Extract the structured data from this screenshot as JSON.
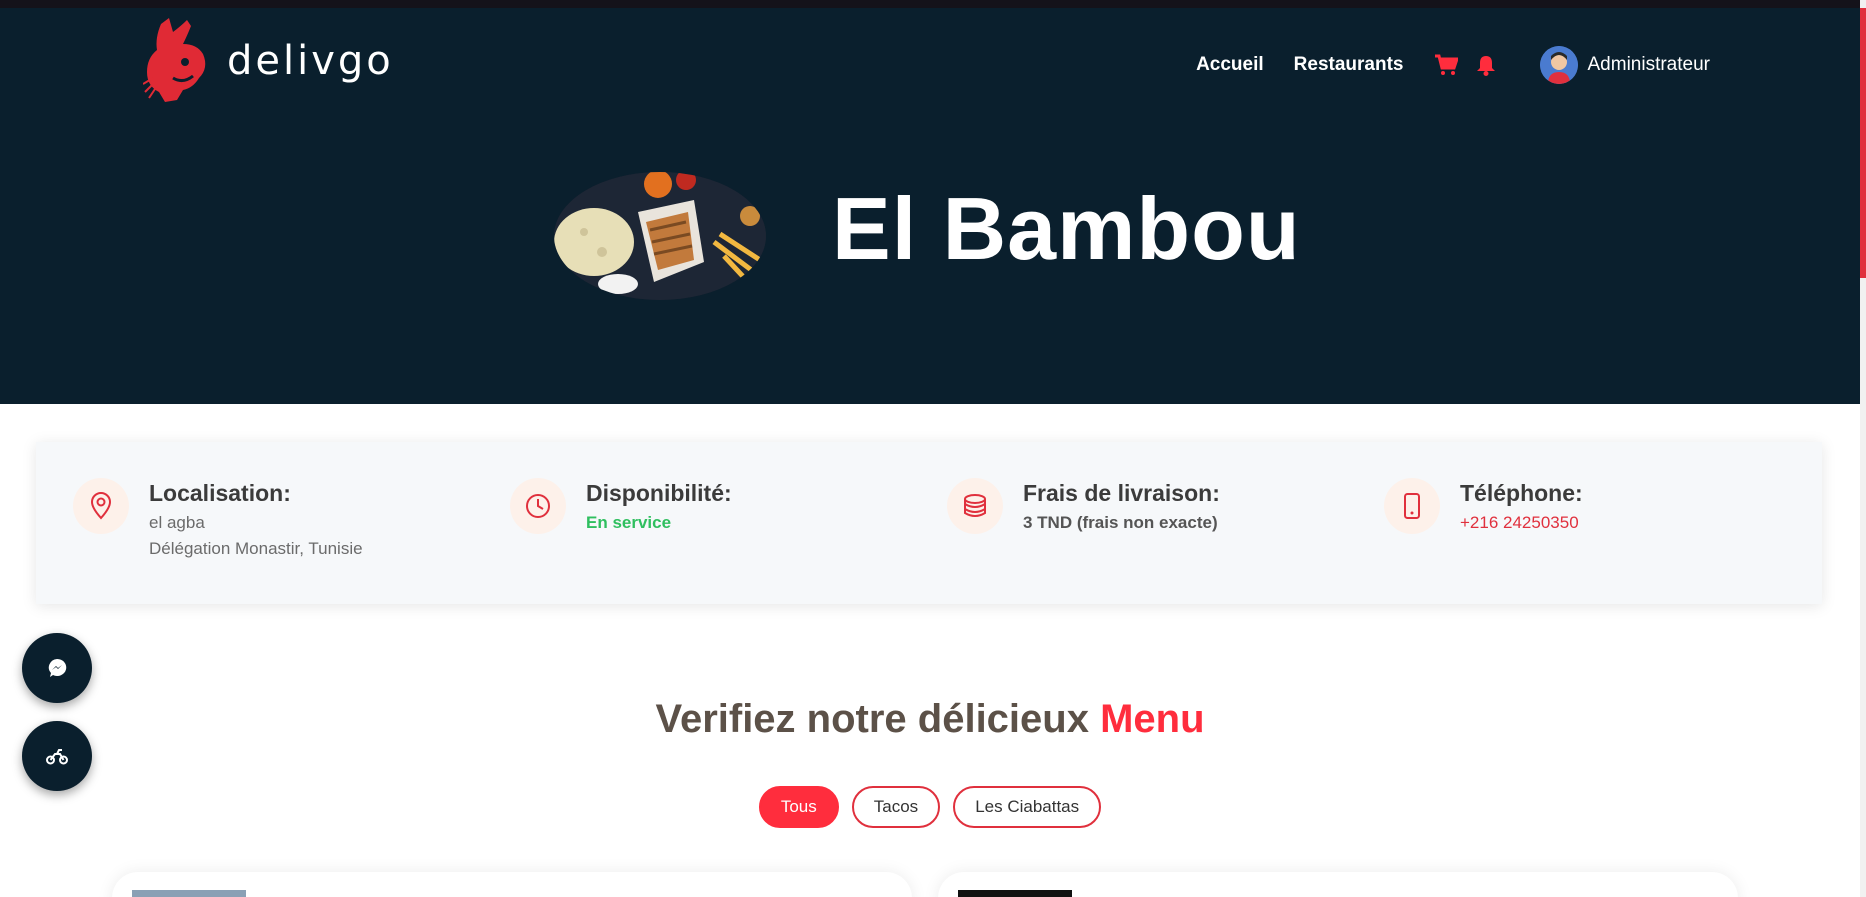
{
  "brand": {
    "name": "delivgo"
  },
  "nav": {
    "links": [
      "Accueil",
      "Restaurants"
    ],
    "icons": [
      "cart-icon",
      "bell-icon"
    ],
    "user_name": "Administrateur"
  },
  "restaurant": {
    "name": "El Bambou"
  },
  "info": {
    "location": {
      "label": "Localisation:",
      "line1": "el agba",
      "line2": "Délégation Monastir, Tunisie"
    },
    "availability": {
      "label": "Disponibilité:",
      "value": "En service"
    },
    "delivery": {
      "label": "Frais de livraison:",
      "value": "3 TND (frais non exacte)"
    },
    "phone": {
      "label": "Téléphone:",
      "value": "+216 24250350"
    }
  },
  "menu": {
    "title_main": "Verifiez notre délicieux",
    "title_accent": "Menu",
    "filters": [
      "Tous",
      "Tacos",
      "Les Ciabattas"
    ],
    "active_filter": "Tous"
  },
  "colors": {
    "primary": "#ff2d3d",
    "dark": "#0a1f2d",
    "success": "#2fbf5f"
  }
}
